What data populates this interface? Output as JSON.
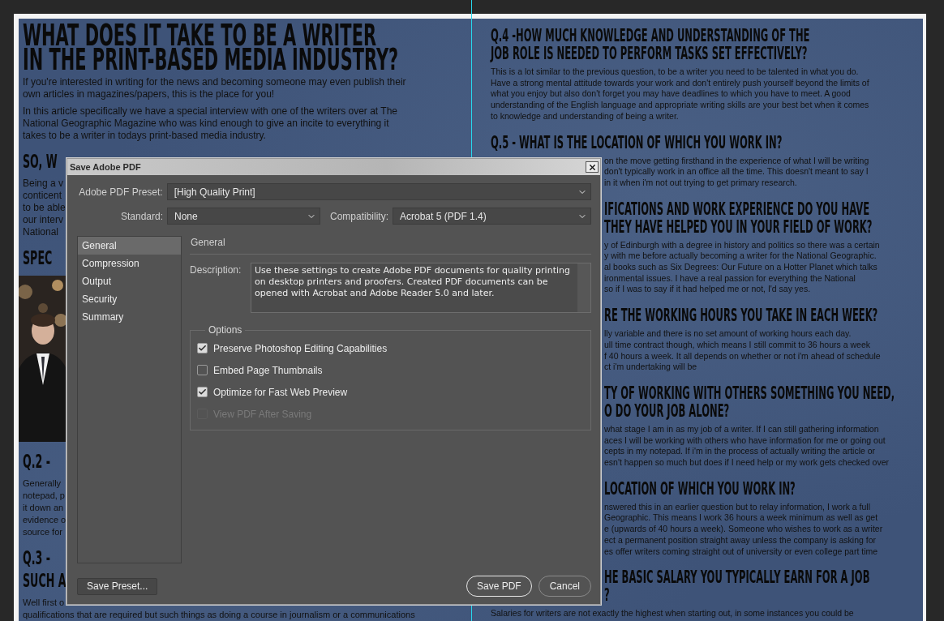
{
  "article": {
    "left_column": [
      {
        "kind": "title",
        "lines": [
          "WHAT DOES IT TAKE TO BE A WRITER",
          "IN THE PRINT-BASED MEDIA INDUSTRY?"
        ]
      },
      {
        "kind": "intro",
        "lines": [
          "If you're interested in writing for the news and becoming someone may even publish their",
          "own articles in magazines/papers, this is the place for you!"
        ]
      },
      {
        "kind": "intro",
        "lines": [
          "In this article specifically we have a special interview with one of the writers over at The",
          "National Geographic Magazine who was kind enough to give an incite to everything it",
          "takes to be a writer in todays print-based media industry."
        ]
      },
      {
        "kind": "heading",
        "lines": [
          "SO, W"
        ]
      },
      {
        "kind": "intro",
        "lines": [
          "Being a v",
          "conticent",
          "to be able",
          "our interv",
          "National"
        ]
      },
      {
        "kind": "heading",
        "lines": [
          "SPEC"
        ]
      },
      {
        "kind": "picture"
      },
      {
        "kind": "heading",
        "lines": [
          "Q.2 -"
        ]
      },
      {
        "kind": "paragraph",
        "lines": [
          "Generally",
          "notepad, p",
          "it down an",
          "evidence o",
          "source for"
        ]
      },
      {
        "kind": "heading",
        "lines": [
          "Q.3 -",
          "SUCH A"
        ]
      },
      {
        "kind": "paragraph",
        "lines": [
          "Well first o",
          "qualifications that are required but such things as doing a course in journalism or a communications"
        ]
      }
    ],
    "right_column": [
      {
        "kind": "heading",
        "lines": [
          "Q.4 -HOW MUCH KNOWLEDGE AND UNDERSTANDING OF THE",
          "JOB ROLE IS NEEDED TO PERFORM TASKS SET EFFECTIVELY?"
        ]
      },
      {
        "kind": "paragraph",
        "lines": [
          "This is a lot similar to the previous question, to be a writer you need to be talented in what you do.",
          "Have a strong mental attitude towards your work and don't entirely push yourself beyond the limits of",
          "what you enjoy but also don't forget you may have deadlines to which you have to meet. A good",
          "understanding of the English language and appropriate writing skills are your best bet when it comes",
          "to knowledge and understanding of being a writer."
        ]
      },
      {
        "kind": "heading",
        "lines": [
          "Q.5 - WHAT IS THE LOCATION OF WHICH YOU WORK IN?"
        ]
      },
      {
        "kind": "paragraph-tail",
        "lines": [
          "on the move getting firsthand in the experience of what I will be writing",
          "don't typically work in an office all the time. This doesn't meant to say I",
          "in it when i'm not out trying to get primary research."
        ]
      },
      {
        "kind": "heading-tail",
        "lines": [
          "IFICATIONS AND WORK EXPERIENCE DO YOU HAVE",
          "THEY HAVE HELPED YOU IN YOUR FIELD OF WORK?"
        ]
      },
      {
        "kind": "paragraph-tail",
        "lines": [
          "y of Edinburgh with a degree in history and politics so there was a certain",
          "y with me before actually becoming a writer for the National Geographic.",
          "al books such as Six Degrees: Our Future on a Hotter Planet which talks",
          "ironmental issues. I have a real passion for everything the National",
          "so if I was to say if it had helped me or not, I'd say yes."
        ]
      },
      {
        "kind": "heading-tail",
        "lines": [
          "RE THE WORKING HOURS YOU TAKE IN EACH WEEK?"
        ]
      },
      {
        "kind": "paragraph-tail",
        "lines": [
          "lly variable and there is no set amount of working hours each day.",
          "ull time contract though, which means I still commit to 36 hours a week",
          "f 40 hours a week. It all depends on whether or not i'm ahead of schedule",
          "ct i'm undertaking will be"
        ]
      },
      {
        "kind": "heading-tail",
        "lines": [
          "TY OF WORKING WITH OTHERS SOMETHING YOU NEED,",
          "O DO YOUR JOB ALONE?"
        ]
      },
      {
        "kind": "paragraph-tail",
        "lines": [
          "what stage I am in as my job of a writer. If I can still gathering information",
          "aces I will be working with others who have information for me or going out",
          "cepts in my notepad. If i'm in the process of actually writing the article or",
          "esn't happen so much but does if I need help or my work gets checked over"
        ]
      },
      {
        "kind": "heading-tail",
        "lines": [
          "LOCATION OF WHICH YOU WORK IN?"
        ]
      },
      {
        "kind": "paragraph-tail",
        "lines": [
          "nswered this in an earlier question but to relay information, I work a full",
          "Geographic. This means I work 36 hours a week minimum as well as get",
          "e (upwards of 40 hours a week). Someone who wishes to work as a writer",
          "ect a permanent position straight away unless the company is asking for",
          "es offer writers coming straight out of university or even college part time"
        ]
      },
      {
        "kind": "heading-tail",
        "lines": [
          "HE BASIC SALARY YOU TYPICALLY EARN FOR A JOB",
          "?"
        ]
      },
      {
        "kind": "paragraph",
        "lines": [
          "Salaries for writers are not exactly the highest when starting out, in some instances you could be"
        ]
      }
    ]
  },
  "dialog": {
    "title": "Save Adobe PDF",
    "preset": {
      "label": "Adobe PDF Preset:",
      "value": "[High Quality Print]"
    },
    "standard": {
      "label": "Standard:",
      "value": "None"
    },
    "compatibility": {
      "label": "Compatibility:",
      "value": "Acrobat 5 (PDF 1.4)"
    },
    "sections": [
      {
        "label": "General",
        "selected": true
      },
      {
        "label": "Compression",
        "selected": false
      },
      {
        "label": "Output",
        "selected": false
      },
      {
        "label": "Security",
        "selected": false
      },
      {
        "label": "Summary",
        "selected": false
      }
    ],
    "panel_title": "General",
    "description": {
      "label": "Description:",
      "value": "Use these settings to create Adobe PDF documents for quality printing on desktop printers and proofers.  Created PDF documents can be opened with Acrobat and Adobe Reader 5.0 and later."
    },
    "options": {
      "legend": "Options",
      "items": [
        {
          "label": "Preserve Photoshop Editing Capabilities",
          "checked": true,
          "disabled": false
        },
        {
          "label": "Embed Page Thumbnails",
          "checked": false,
          "disabled": false
        },
        {
          "label": "Optimize for Fast Web Preview",
          "checked": true,
          "disabled": false
        },
        {
          "label": "View PDF After Saving",
          "checked": false,
          "disabled": true
        }
      ]
    },
    "buttons": [
      {
        "label": "Save Preset...",
        "kind": "plain"
      },
      {
        "label": "Save PDF",
        "kind": "default"
      },
      {
        "label": "Cancel",
        "kind": "pill"
      }
    ]
  }
}
